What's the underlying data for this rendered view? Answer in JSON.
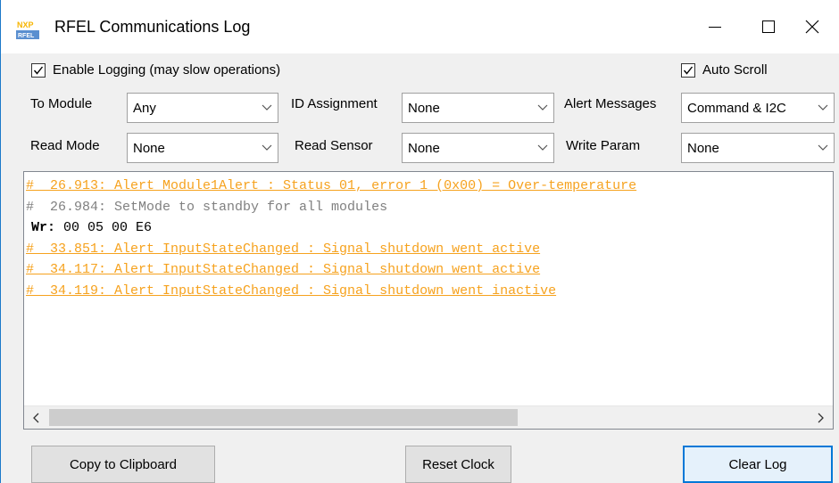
{
  "window": {
    "title": "RFEL Communications Log",
    "app_icon": {
      "text_top": "NXP",
      "text_bottom": "RFEL"
    },
    "controls": [
      "minimize-icon",
      "maximize-icon",
      "close-icon"
    ]
  },
  "options": {
    "enable_logging": {
      "label": "Enable Logging (may slow operations)",
      "checked": true
    },
    "auto_scroll": {
      "label": "Auto Scroll",
      "checked": true
    }
  },
  "filters": {
    "to_module": {
      "label": "To Module",
      "value": "Any"
    },
    "id_assignment": {
      "label": "ID Assignment",
      "value": "None"
    },
    "alert_messages": {
      "label": "Alert Messages",
      "value": "Command & I2C"
    },
    "read_mode": {
      "label": "Read Mode",
      "value": "None"
    },
    "read_sensor": {
      "label": "Read Sensor",
      "value": "None"
    },
    "write_param": {
      "label": "Write Param",
      "value": "None"
    }
  },
  "log": {
    "lines": [
      {
        "type": "alert",
        "text": "#  26.913: Alert Module1Alert : Status 01, error 1 (0x00) = Over-temperature"
      },
      {
        "type": "info",
        "text": "#  26.984: SetMode to standby for all modules"
      },
      {
        "type": "wr",
        "prefix": "Wr:",
        "text": " 00 05 00 E6"
      },
      {
        "type": "alert",
        "text": "#  33.851: Alert InputStateChanged : Signal shutdown went active"
      },
      {
        "type": "alert",
        "text": "#  34.117: Alert InputStateChanged : Signal shutdown went active"
      },
      {
        "type": "alert",
        "text": "#  34.119: Alert InputStateChanged : Signal shutdown went inactive"
      }
    ]
  },
  "buttons": {
    "copy": "Copy to Clipboard",
    "reset": "Reset Clock",
    "clear": "Clear Log"
  },
  "colors": {
    "alert": "#f6a21e",
    "info": "#808080",
    "accent": "#0078d7"
  }
}
